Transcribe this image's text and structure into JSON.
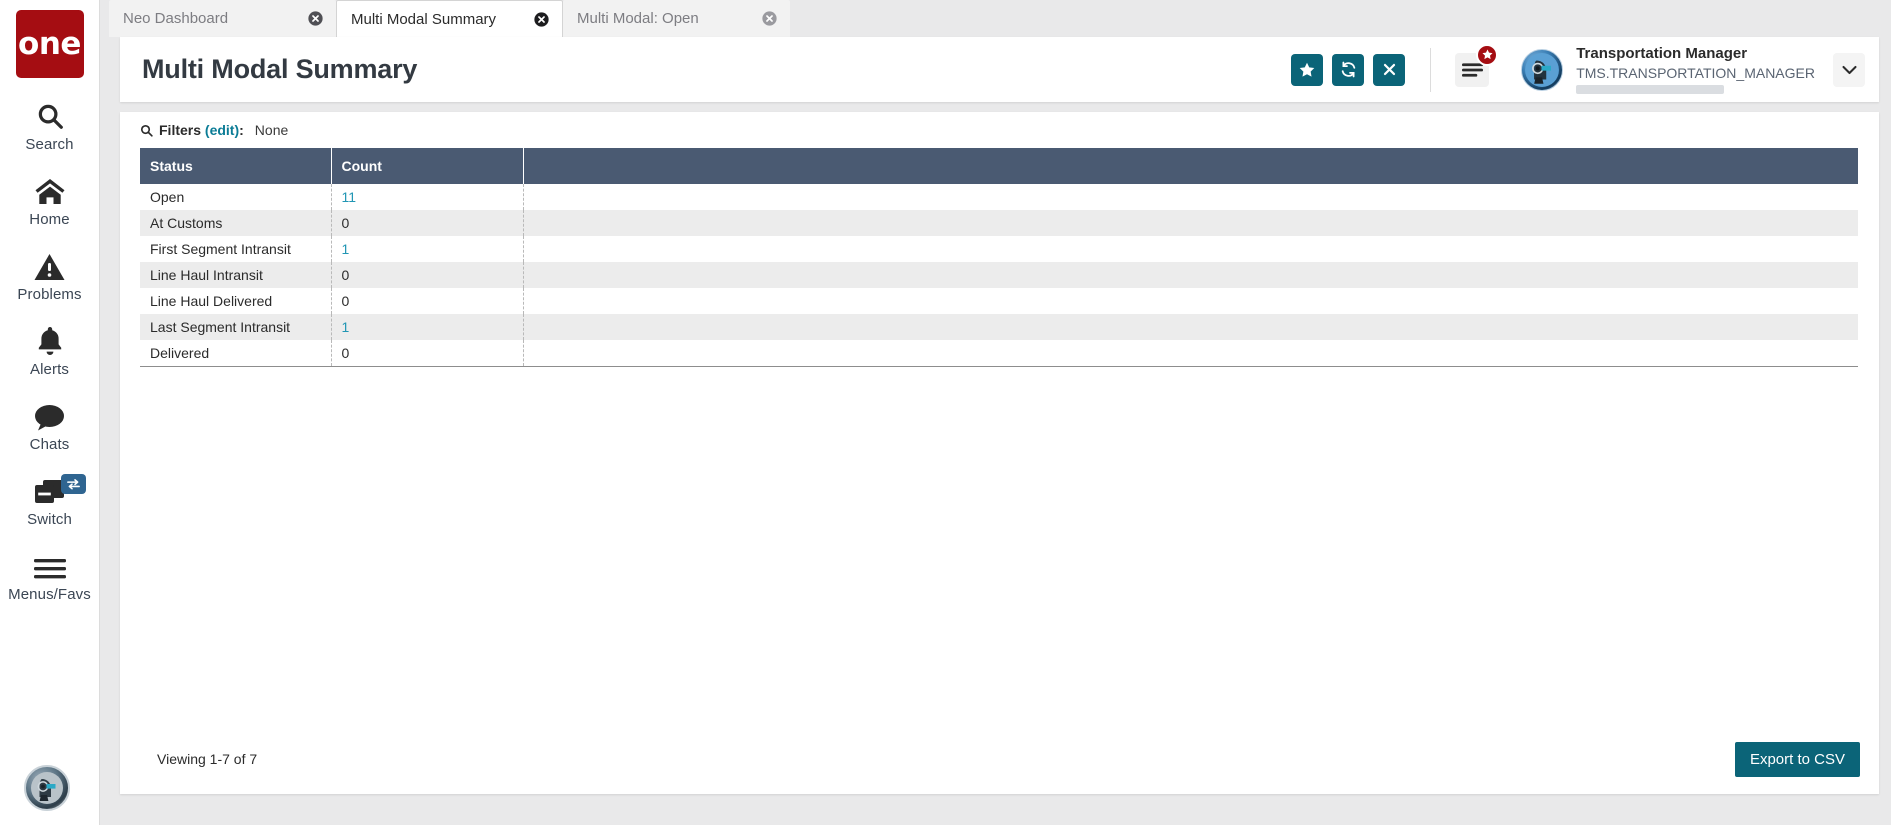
{
  "brand": {
    "logo_text": "one"
  },
  "rail": {
    "items": [
      {
        "label": "Search",
        "icon": "search-icon"
      },
      {
        "label": "Home",
        "icon": "home-icon"
      },
      {
        "label": "Problems",
        "icon": "warning-triangle-icon"
      },
      {
        "label": "Alerts",
        "icon": "bell-icon"
      },
      {
        "label": "Chats",
        "icon": "chat-bubble-icon"
      },
      {
        "label": "Switch",
        "icon": "windows-stack-icon"
      },
      {
        "label": "Menus/Favs",
        "icon": "hamburger-icon"
      }
    ],
    "switch_badge_icon": "swap-arrows-icon",
    "avatar_icon": "robot-avatar-icon"
  },
  "tabs": [
    {
      "label": "Neo Dashboard",
      "active": false,
      "closable": true
    },
    {
      "label": "Multi Modal Summary",
      "active": true,
      "closable": true
    },
    {
      "label": "Multi Modal: Open",
      "active": false,
      "closable": true
    }
  ],
  "header": {
    "title": "Multi Modal Summary",
    "actions": [
      {
        "name": "favorite-button",
        "icon": "star-icon"
      },
      {
        "name": "refresh-button",
        "icon": "refresh-icon"
      },
      {
        "name": "close-button",
        "icon": "close-x-icon"
      }
    ],
    "menu_icon": "hamburger-icon",
    "menu_badge_icon": "star-icon",
    "user": {
      "name": "Transportation Manager",
      "login": "TMS.TRANSPORTATION_MANAGER",
      "avatar_icon": "robot-avatar-icon",
      "caret_icon": "chevron-down-icon"
    }
  },
  "filters": {
    "icon": "search-icon",
    "label": "Filters",
    "edit_label": "(edit)",
    "colon": ":",
    "value": "None"
  },
  "table": {
    "columns": [
      "Status",
      "Count"
    ],
    "rows": [
      {
        "status": "Open",
        "count": "11",
        "is_link": true
      },
      {
        "status": "At Customs",
        "count": "0",
        "is_link": false
      },
      {
        "status": "First Segment Intransit",
        "count": "1",
        "is_link": true
      },
      {
        "status": "Line Haul Intransit",
        "count": "0",
        "is_link": false
      },
      {
        "status": "Line Haul Delivered",
        "count": "0",
        "is_link": false
      },
      {
        "status": "Last Segment Intransit",
        "count": "1",
        "is_link": true
      },
      {
        "status": "Delivered",
        "count": "0",
        "is_link": false
      }
    ]
  },
  "footer": {
    "viewing_text": "Viewing 1-7 of 7",
    "export_label": "Export to CSV"
  },
  "colors": {
    "brand_red": "#a50d12",
    "teal": "#0b6478",
    "link_teal": "#2196b4",
    "table_header": "#4a5a72",
    "tab_active_underline": "#0b6478"
  }
}
